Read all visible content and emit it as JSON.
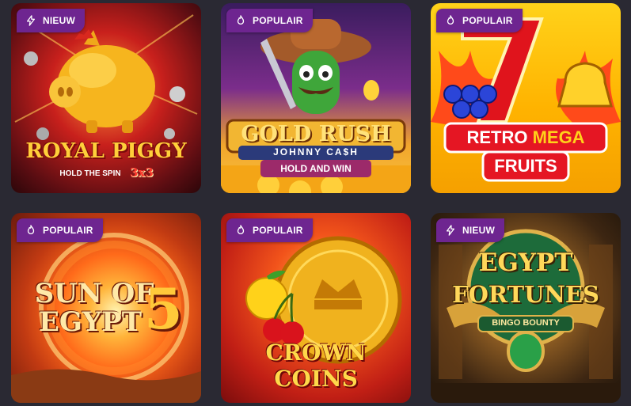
{
  "games": [
    {
      "name": "Royal Piggy",
      "logo_line1": "ROYAL PIGGY",
      "logo_sub": "HOLD THE SPIN",
      "logo_extra": "3x3",
      "badge": "NIEUW",
      "badge_icon": "lightning-icon"
    },
    {
      "name": "Gold Rush Johnny Cash",
      "logo_line1": "GOLD RUSH",
      "logo_line2": "JOHNNY CA$H",
      "logo_sub": "HOLD AND WIN",
      "badge": "POPULAIR",
      "badge_icon": "flame-icon"
    },
    {
      "name": "Retro Mega Fruits",
      "logo_line1": "RETRO",
      "logo_line1b": "MEGA",
      "logo_line2": "FRUITS",
      "badge": "POPULAIR",
      "badge_icon": "flame-icon"
    },
    {
      "name": "Sun of Egypt 5",
      "logo_line1": "SUN OF",
      "logo_line2": "EGYPT",
      "logo_extra": "5",
      "badge": "POPULAIR",
      "badge_icon": "flame-icon"
    },
    {
      "name": "Crown Coins",
      "logo_line1": "CROWN COINS",
      "badge": "POPULAIR",
      "badge_icon": "flame-icon"
    },
    {
      "name": "Egypt Fortunes",
      "logo_line1": "EGYPT",
      "logo_line2": "FORTUNES",
      "logo_sub": "BINGO BOUNTY",
      "badge": "NIEUW",
      "badge_icon": "lightning-icon"
    }
  ],
  "colors": {
    "background": "#2a2933",
    "badge": "#6e2590",
    "badge_text": "#ffffff"
  }
}
